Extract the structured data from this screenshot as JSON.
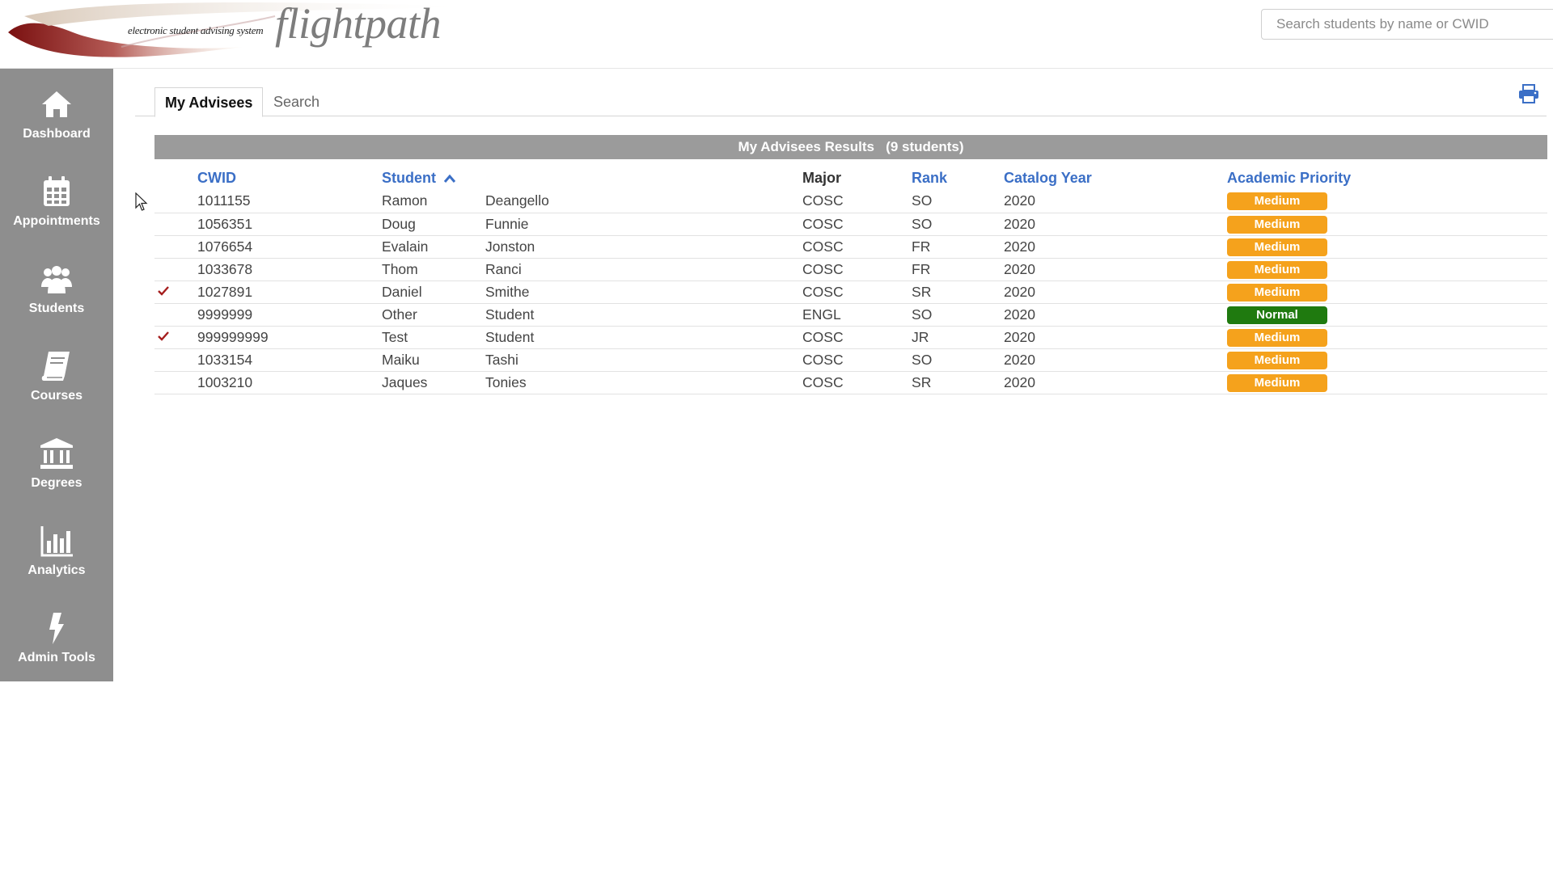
{
  "header": {
    "logo_small": "electronic student advising system",
    "logo_big": "flightpath",
    "search_placeholder": "Search students by name or CWID"
  },
  "sidebar": {
    "items": [
      {
        "label": "Dashboard",
        "icon": "home-icon"
      },
      {
        "label": "Appointments",
        "icon": "calendar-icon"
      },
      {
        "label": "Students",
        "icon": "users-icon"
      },
      {
        "label": "Courses",
        "icon": "book-icon"
      },
      {
        "label": "Degrees",
        "icon": "institution-icon"
      },
      {
        "label": "Analytics",
        "icon": "bar-chart-icon"
      },
      {
        "label": "Admin Tools",
        "icon": "bolt-icon"
      }
    ]
  },
  "tabs": [
    {
      "label": "My Advisees",
      "active": true
    },
    {
      "label": "Search",
      "active": false
    }
  ],
  "results": {
    "title": "My Advisees Results",
    "count_text": "(9 students)"
  },
  "table": {
    "columns": {
      "cwid": "CWID",
      "student": "Student",
      "major": "Major",
      "rank": "Rank",
      "catalog_year": "Catalog Year",
      "priority": "Academic Priority"
    },
    "rows": [
      {
        "checked": false,
        "cwid": "1011155",
        "first": "Ramon",
        "last": "Deangello",
        "major": "COSC",
        "rank": "SO",
        "year": "2020",
        "priority": "Medium"
      },
      {
        "checked": false,
        "cwid": "1056351",
        "first": "Doug",
        "last": "Funnie",
        "major": "COSC",
        "rank": "SO",
        "year": "2020",
        "priority": "Medium"
      },
      {
        "checked": false,
        "cwid": "1076654",
        "first": "Evalain",
        "last": "Jonston",
        "major": "COSC",
        "rank": "FR",
        "year": "2020",
        "priority": "Medium"
      },
      {
        "checked": false,
        "cwid": "1033678",
        "first": "Thom",
        "last": "Ranci",
        "major": "COSC",
        "rank": "FR",
        "year": "2020",
        "priority": "Medium"
      },
      {
        "checked": true,
        "cwid": "1027891",
        "first": "Daniel",
        "last": "Smithe",
        "major": "COSC",
        "rank": "SR",
        "year": "2020",
        "priority": "Medium"
      },
      {
        "checked": false,
        "cwid": "9999999",
        "first": "Other",
        "last": "Student",
        "major": "ENGL",
        "rank": "SO",
        "year": "2020",
        "priority": "Normal"
      },
      {
        "checked": true,
        "cwid": "999999999",
        "first": "Test",
        "last": "Student",
        "major": "COSC",
        "rank": "JR",
        "year": "2020",
        "priority": "Medium"
      },
      {
        "checked": false,
        "cwid": "1033154",
        "first": "Maiku",
        "last": "Tashi",
        "major": "COSC",
        "rank": "SO",
        "year": "2020",
        "priority": "Medium"
      },
      {
        "checked": false,
        "cwid": "1003210",
        "first": "Jaques",
        "last": "Tonies",
        "major": "COSC",
        "rank": "SR",
        "year": "2020",
        "priority": "Medium"
      }
    ]
  },
  "colors": {
    "sidebar_bg": "#8e8e8e",
    "link_blue": "#3b6fc6",
    "priority_medium": "#f5a21c",
    "priority_normal": "#1f7a0f",
    "checkmark": "#a51d1d"
  }
}
